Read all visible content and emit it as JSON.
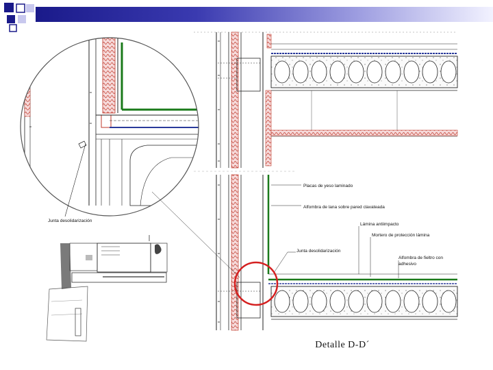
{
  "colors": {
    "title_bar": "#1a1a8a",
    "insulation": "#c0392b",
    "finish_layer": "#1a7a1a",
    "highlight_circle": "#d42020",
    "linework": "#222222"
  },
  "labels": {
    "junta_circle": "Junta desolidarización",
    "placas_yeso": "Placas de yeso laminado",
    "alfombra_lana": "Alfombra de lana sobre pared clavateada",
    "lamina_antiimpacto": "Lámina antiimpacto",
    "mortero_proteccion": "Mortero de protección lámina",
    "junta_detail": "Junta desolidarización",
    "alfombra_fieltro_1": "Alfombra de fieltro con",
    "alfombra_fieltro_2": "adhesivo"
  },
  "caption": "Detalle D-D´"
}
